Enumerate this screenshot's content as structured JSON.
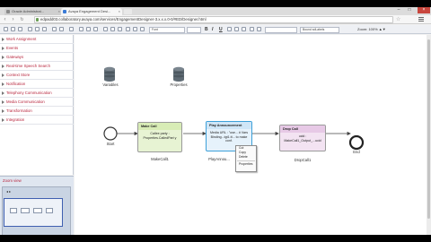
{
  "browser": {
    "tabs": [
      {
        "label": "Oracle Administrat..."
      },
      {
        "label": "Avaya Engagement Desi..."
      }
    ],
    "url": "edpadd03.collaboratory.avaya.com/services/EngagementDesigner-3.x.x.x.0-0/#ED/Designer.html"
  },
  "toolbar": {
    "font_select": "Font",
    "size_select": "",
    "bold": "B",
    "italic": "I",
    "underline": "U",
    "style_select": "",
    "connector_select": "Bound sdLabels",
    "zoom": "Zoom: 100% ▲▼"
  },
  "palette": {
    "items": [
      {
        "label": "Work Assignment"
      },
      {
        "label": "Events"
      },
      {
        "label": "Gateways"
      },
      {
        "label": "Real-time Speech Search"
      },
      {
        "label": "Context Store"
      },
      {
        "label": "Notification"
      },
      {
        "label": "Telephony Communication"
      },
      {
        "label": "Media Communication"
      },
      {
        "label": "Transformation"
      },
      {
        "label": "Integration"
      }
    ]
  },
  "zoom_panel": {
    "title": "Zoom view"
  },
  "canvas": {
    "variables_label": "Variables",
    "properties_label": "Properties",
    "start_label": "Start",
    "end_label": "End",
    "make_call": {
      "header": "Make Call",
      "body": "Callee party : Properties.CalledPart y",
      "caption": "MakeCall1"
    },
    "play_announcement": {
      "header": "Play Announcement",
      "body": "Media URL : \"use... # Vars Binding...tgt1.tt... to make conf.",
      "caption": "PlayAnnou..."
    },
    "drop_call": {
      "header": "Drop Call",
      "body": "ucid : MakeCall1_Output_...ucid",
      "caption": "DropCall1"
    },
    "context_menu": {
      "items": [
        "Cut",
        "Copy",
        "Delete",
        "Properties"
      ]
    }
  },
  "colors": {
    "palette_text": "#b8253d",
    "make_call_header": "#d8ecb6",
    "make_call_body": "#e7f3d3",
    "play_header": "#cfe6f7",
    "play_border": "#3da0d9",
    "drop_header": "#e7c9e6",
    "drop_body": "#f3e3f2"
  }
}
